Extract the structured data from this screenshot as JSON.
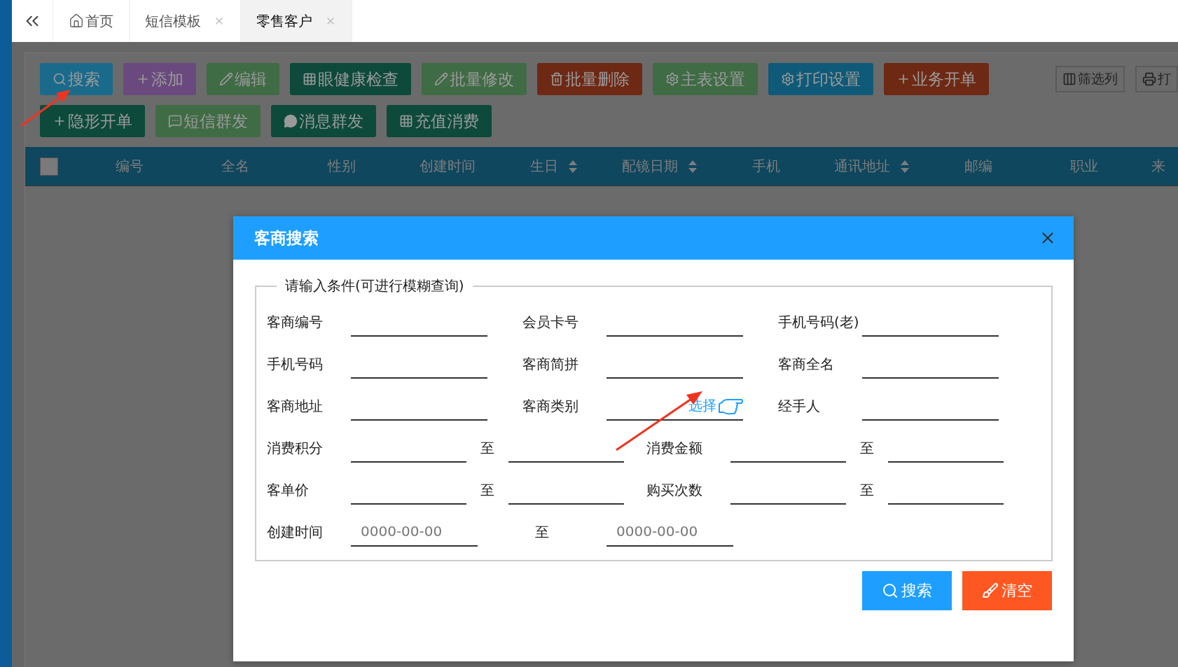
{
  "tabs": [
    {
      "label": "首页",
      "kind": "home",
      "selected": false,
      "closable": false
    },
    {
      "label": "短信模板",
      "kind": "page",
      "selected": false,
      "closable": true
    },
    {
      "label": "零售客户",
      "kind": "page",
      "selected": true,
      "closable": true
    }
  ],
  "toolbar": {
    "buttons": [
      {
        "label": "搜索",
        "kind": "search",
        "color": "#1a6a8c"
      },
      {
        "label": "添加",
        "kind": "plus",
        "color": "#6a4a7e"
      },
      {
        "label": "编辑",
        "kind": "pencil",
        "color": "#3f6b45"
      },
      {
        "label": "眼健康检查",
        "kind": "grid",
        "color": "#0d4a3b"
      },
      {
        "label": "批量修改",
        "kind": "pencil",
        "color": "#3f6b45"
      },
      {
        "label": "批量删除",
        "kind": "trash",
        "color": "#6e2914"
      },
      {
        "label": "主表设置",
        "kind": "gear",
        "color": "#3f6b45"
      },
      {
        "label": "打印设置",
        "kind": "gear",
        "color": "#0f5a78"
      },
      {
        "label": "业务开单",
        "kind": "plus",
        "color": "#6e2914"
      },
      {
        "label": "隐形开单",
        "kind": "plus",
        "color": "#0d4a3b"
      },
      {
        "label": "短信群发",
        "kind": "chat",
        "color": "#3f6b45"
      },
      {
        "label": "消息群发",
        "kind": "bubble",
        "color": "#0d4a3b"
      },
      {
        "label": "充值消费",
        "kind": "grid",
        "color": "#0d4a3b"
      }
    ],
    "tools": [
      {
        "label": "筛选列",
        "kind": "columns"
      },
      {
        "label": "打",
        "kind": "printer"
      }
    ]
  },
  "table": {
    "checked": false,
    "columns": [
      {
        "label": "编号",
        "sortable": false
      },
      {
        "label": "全名",
        "sortable": false
      },
      {
        "label": "性别",
        "sortable": false
      },
      {
        "label": "创建时间",
        "sortable": false
      },
      {
        "label": "生日",
        "sortable": true
      },
      {
        "label": "配镜日期",
        "sortable": true
      },
      {
        "label": "手机",
        "sortable": false
      },
      {
        "label": "通讯地址",
        "sortable": true
      },
      {
        "label": "邮编",
        "sortable": false
      },
      {
        "label": "职业",
        "sortable": false
      },
      {
        "label": "来",
        "sortable": false
      }
    ]
  },
  "dialog": {
    "title": "客商搜索",
    "legend": "请输入条件(可进行模糊查询)",
    "rows": [
      [
        {
          "kind": "field",
          "label": "客商编号"
        },
        {
          "kind": "field",
          "label": "会员卡号"
        },
        {
          "kind": "field",
          "label": "手机号码(老)"
        }
      ],
      [
        {
          "kind": "field",
          "label": "手机号码"
        },
        {
          "kind": "field",
          "label": "客商简拼"
        },
        {
          "kind": "field",
          "label": "客商全名"
        }
      ],
      [
        {
          "kind": "field",
          "label": "客商地址"
        },
        {
          "kind": "field",
          "label": "客商类别",
          "link": "选择"
        },
        {
          "kind": "field",
          "label": "经手人"
        }
      ],
      [
        {
          "kind": "range",
          "label": "消费积分",
          "to": "至"
        },
        {
          "kind": "range",
          "label": "消费金额",
          "to": "至"
        }
      ],
      [
        {
          "kind": "range",
          "label": "客单价",
          "to": "至"
        },
        {
          "kind": "range",
          "label": "购买次数",
          "to": "至"
        }
      ],
      [
        {
          "kind": "date_range",
          "label": "创建时间",
          "to": "至",
          "placeholders": [
            "0000-00-00",
            "0000-00-00"
          ]
        }
      ]
    ],
    "buttons": [
      {
        "label": "搜索",
        "kind": "search"
      },
      {
        "label": "清空",
        "kind": "clear"
      }
    ]
  }
}
